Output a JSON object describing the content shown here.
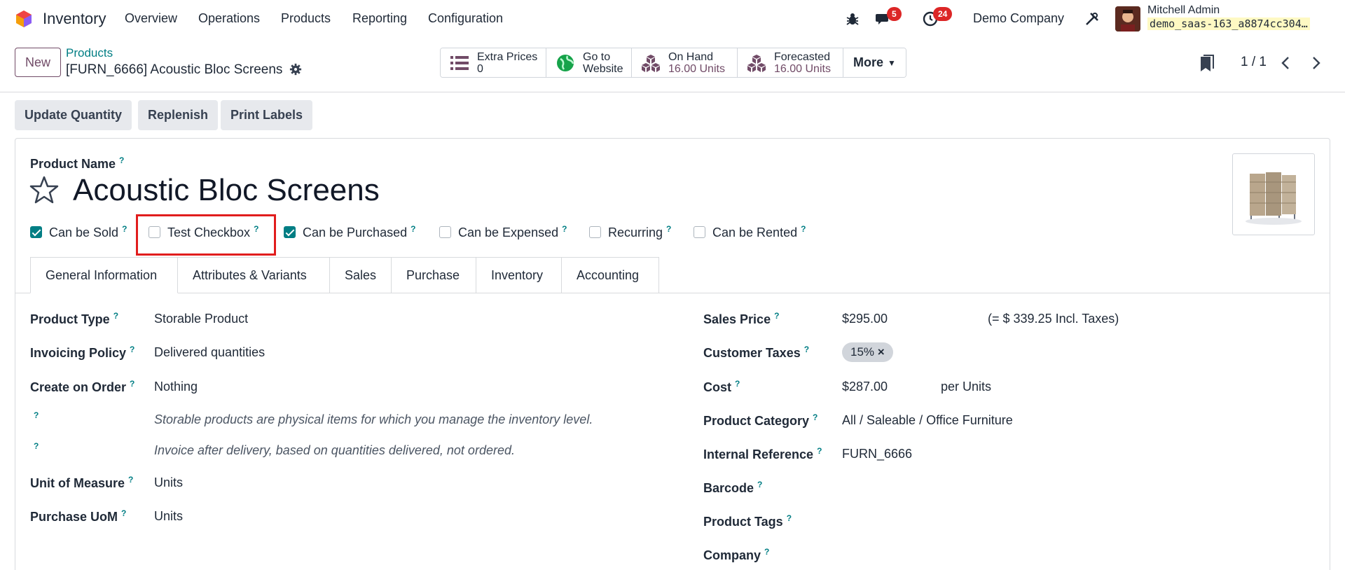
{
  "nav": {
    "app_name": "Inventory",
    "menus": [
      "Overview",
      "Operations",
      "Products",
      "Reporting",
      "Configuration"
    ],
    "messages_badge": "5",
    "activities_badge": "24",
    "company": "Demo Company",
    "user_name": "Mitchell Admin",
    "db_name": "demo_saas-163_a8874cc304…",
    "icons": [
      "bug-icon",
      "chat-icon",
      "clock-icon",
      "tools-icon"
    ]
  },
  "control": {
    "new_label": "New",
    "breadcrumb_parent": "Products",
    "breadcrumb_current": "[FURN_6666] Acoustic Bloc Screens",
    "stats": [
      {
        "icon": "list-icon",
        "label": "Extra Prices",
        "value": "0"
      },
      {
        "icon": "globe-icon",
        "label": "Go to",
        "value": "Website"
      },
      {
        "icon": "cubes-icon",
        "label": "On Hand",
        "value": "16.00 Units"
      },
      {
        "icon": "cubes-icon",
        "label": "Forecasted",
        "value": "16.00 Units"
      }
    ],
    "more_label": "More",
    "pager": "1 / 1"
  },
  "actions": [
    "Update Quantity",
    "Replenish",
    "Print Labels"
  ],
  "form": {
    "product_name_label": "Product Name",
    "product_name": "Acoustic Bloc Screens",
    "checkboxes": [
      {
        "label": "Can be Sold",
        "checked": true
      },
      {
        "label": "Test Checkbox",
        "checked": false
      },
      {
        "label": "Can be Purchased",
        "checked": true
      },
      {
        "label": "Can be Expensed",
        "checked": false
      },
      {
        "label": "Recurring",
        "checked": false
      },
      {
        "label": "Can be Rented",
        "checked": false
      }
    ],
    "tabs": [
      "General Information",
      "Attributes & Variants",
      "Sales",
      "Purchase",
      "Inventory",
      "Accounting"
    ],
    "left": {
      "product_type_label": "Product Type",
      "product_type": "Storable Product",
      "invoicing_policy_label": "Invoicing Policy",
      "invoicing_policy": "Delivered quantities",
      "create_on_order_label": "Create on Order",
      "create_on_order": "Nothing",
      "help_type": "Storable products are physical items for which you manage the inventory level.",
      "help_invoice": "Invoice after delivery, based on quantities delivered, not ordered.",
      "uom_label": "Unit of Measure",
      "uom": "Units",
      "purchase_uom_label": "Purchase UoM",
      "purchase_uom": "Units"
    },
    "right": {
      "sales_price_label": "Sales Price",
      "sales_price": "$295.00",
      "incl_taxes": "(= $ 339.25 Incl. Taxes)",
      "customer_taxes_label": "Customer Taxes",
      "customer_tax": "15%",
      "cost_label": "Cost",
      "cost": "$287.00",
      "cost_unit": "per Units",
      "category_label": "Product Category",
      "category": "All / Saleable / Office Furniture",
      "internal_ref_label": "Internal Reference",
      "internal_ref": "FURN_6666",
      "barcode_label": "Barcode",
      "tags_label": "Product Tags",
      "company_label": "Company"
    }
  },
  "colors": {
    "brand": "#714b67",
    "teal": "#017e84",
    "highlight": "#e11d1d",
    "badge": "#dc2626"
  }
}
